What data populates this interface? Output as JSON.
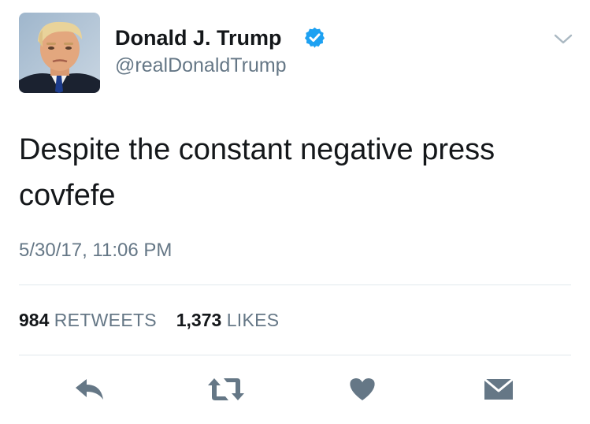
{
  "author": {
    "name": "Donald J. Trump",
    "handle": "@realDonaldTrump",
    "verified": true,
    "avatar_icon": "profile-photo"
  },
  "tweet": {
    "text_line1": "Despite the constant negative press",
    "text_line2": "covfefe",
    "timestamp": "5/30/17, 11:06 PM"
  },
  "stats": {
    "retweets_count": "984",
    "retweets_label": "RETWEETS",
    "likes_count": "1,373",
    "likes_label": "LIKES"
  },
  "actions": [
    {
      "name": "reply",
      "icon": "reply-icon"
    },
    {
      "name": "retweet",
      "icon": "retweet-icon"
    },
    {
      "name": "like",
      "icon": "heart-icon"
    },
    {
      "name": "direct-message",
      "icon": "envelope-icon"
    }
  ],
  "colors": {
    "text_primary": "#14171a",
    "text_secondary": "#657786",
    "verified_blue": "#1da1f2",
    "action_gray": "#657786",
    "divider": "#e1e8ed"
  }
}
